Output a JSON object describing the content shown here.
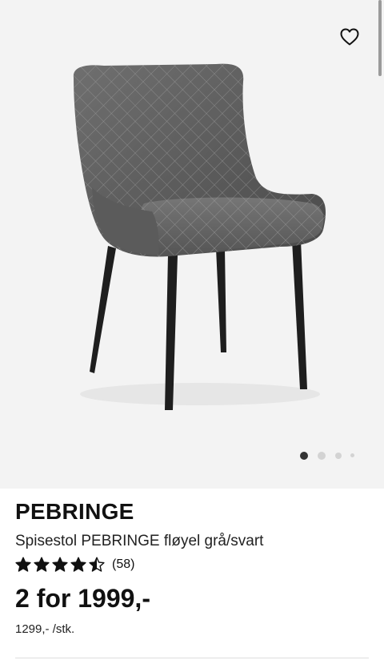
{
  "product": {
    "name": "PEBRINGE",
    "description": "Spisestol PEBRINGE fløyel grå/svart",
    "rating": {
      "value": 4.5,
      "max": 5,
      "count_label": "(58)"
    },
    "price": "2 for 1999,-",
    "unit_price": "1299,- /stk."
  },
  "gallery": {
    "image_subject": "grey quilted velvet dining chair with black legs",
    "current_index": 1,
    "total_dots": 4
  },
  "icons": {
    "favorite": "heart-outline-icon",
    "star": "star-icon"
  },
  "colors": {
    "hero_bg": "#f3f3f3",
    "active_dot": "#333333",
    "inactive_dot": "#d3d3d3",
    "text": "#111111"
  }
}
